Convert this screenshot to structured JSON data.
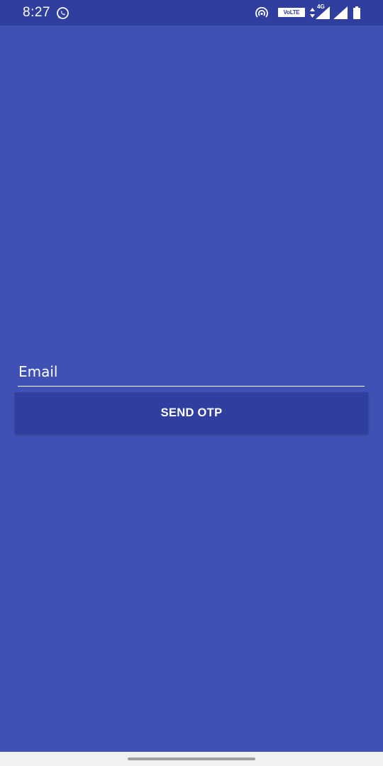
{
  "status_bar": {
    "time": "8:27",
    "volte_label": "VoLTE",
    "network_type": "4G",
    "icons": [
      "whatsapp-icon",
      "hotspot-icon",
      "volte-icon",
      "data-arrows-icon",
      "signal-icon",
      "signal-icon",
      "battery-icon"
    ]
  },
  "form": {
    "email": {
      "placeholder": "Email",
      "value": ""
    },
    "send_button_label": "SEND OTP"
  },
  "colors": {
    "background": "#3f51b5",
    "status_bar": "#303f9f",
    "button": "#303f9f",
    "text": "#ffffff",
    "nav_bar": "#f1f1f1"
  }
}
